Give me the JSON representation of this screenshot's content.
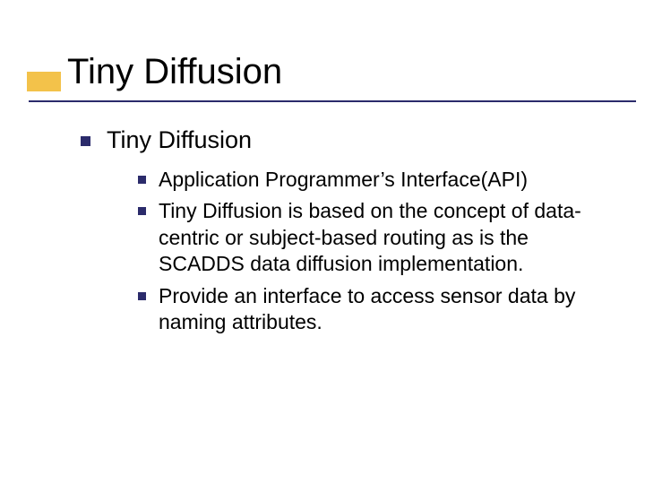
{
  "title": "Tiny Diffusion",
  "items": [
    {
      "text": "Tiny Diffusion",
      "children": [
        {
          "text": "Application Programmer’s Interface(API)"
        },
        {
          "text": "Tiny Diffusion is based on the concept of data-centric or subject-based routing as is the SCADDS data diffusion implementation."
        },
        {
          "text": "Provide an interface to access sensor data by naming attributes."
        }
      ]
    }
  ],
  "colors": {
    "accent": "#f3c24a",
    "rule_and_bullets": "#2b2b6b",
    "text": "#000000",
    "background": "#ffffff"
  }
}
